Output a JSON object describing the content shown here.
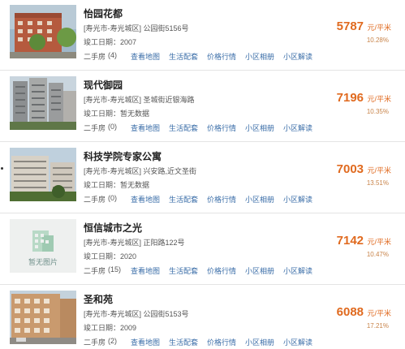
{
  "listings": [
    {
      "name": "怡园花都",
      "address": "[寿光市-寿光城区] 公园街5156号",
      "year": "竣工日期：2007",
      "secondhand": "二手房",
      "count": "(4)",
      "links": [
        "查看地图",
        "生活配套",
        "价格行情",
        "小区相册",
        "小区解读"
      ],
      "price": "5787",
      "unit": "元/平米",
      "change": "10.28%",
      "image": "building-photo"
    },
    {
      "name": "现代御园",
      "address": "[寿光市-寿光城区] 圣城街近银海路",
      "year": "竣工日期：暂无数据",
      "secondhand": "二手房",
      "count": "(0)",
      "links": [
        "查看地图",
        "生活配套",
        "价格行情",
        "小区相册",
        "小区解读"
      ],
      "price": "7196",
      "unit": "元/平米",
      "change": "10.35%",
      "image": "highrise-photo"
    },
    {
      "name": "科技学院专家公寓",
      "address": "[寿光市-寿光城区] 兴安路,近文圣街",
      "year": "竣工日期：暂无数据",
      "secondhand": "二手房",
      "count": "(0)",
      "links": [
        "查看地图",
        "生活配套",
        "价格行情",
        "小区相册",
        "小区解读"
      ],
      "price": "7003",
      "unit": "元/平米",
      "change": "13.51%",
      "image": "apartment-photo"
    },
    {
      "name": "恒信城市之光",
      "address": "[寿光市-寿光城区] 正阳路122号",
      "year": "竣工日期：2020",
      "secondhand": "二手房",
      "count": "(15)",
      "links": [
        "查看地图",
        "生活配套",
        "价格行情",
        "小区相册",
        "小区解读"
      ],
      "price": "7142",
      "unit": "元/平米",
      "change": "10.47%",
      "image": "no-image",
      "no_image_text": "暂无图片"
    },
    {
      "name": "圣和苑",
      "address": "[寿光市-寿光城区] 公园街5153号",
      "year": "竣工日期：2009",
      "secondhand": "二手房",
      "count": "(2)",
      "links": [
        "查看地图",
        "生活配套",
        "价格行情",
        "小区相册",
        "小区解读"
      ],
      "price": "6088",
      "unit": "元/平米",
      "change": "17.21%",
      "image": "building-photo"
    }
  ]
}
